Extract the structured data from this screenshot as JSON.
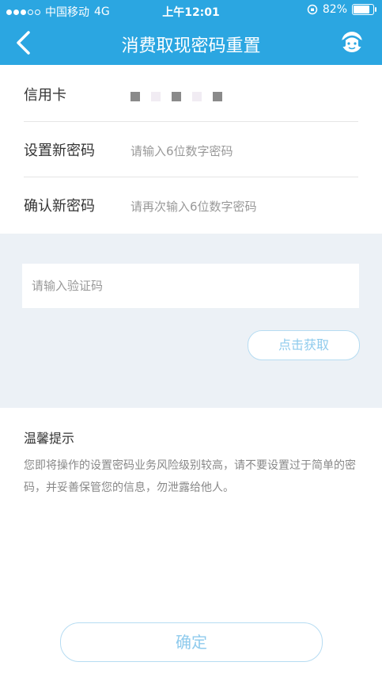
{
  "status_bar": {
    "carrier": "中国移动",
    "network": "4G",
    "time": "上午12:01",
    "battery": "82%",
    "battery_level": 0.82
  },
  "nav": {
    "title": "消费取现密码重置",
    "back_icon": "chevron-left-icon",
    "service_icon": "customer-service-icon"
  },
  "form": {
    "card_label": "信用卡",
    "new_password_label": "设置新密码",
    "new_password_placeholder": "请输入6位数字密码",
    "confirm_password_label": "确认新密码",
    "confirm_password_placeholder": "请再次输入6位数字密码",
    "verification_placeholder": "请输入验证码",
    "get_code_label": "点击获取"
  },
  "tips": {
    "title": "温馨提示",
    "text": "您即将操作的设置密码业务风险级别较高，请不要设置过于简单的密码，并妥善保管您的信息，勿泄露给他人。"
  },
  "confirm_button": "确定",
  "colors": {
    "brand": "#2ba6e1",
    "form_background": "#ecf1f6",
    "button_text": "#8fcbed"
  }
}
